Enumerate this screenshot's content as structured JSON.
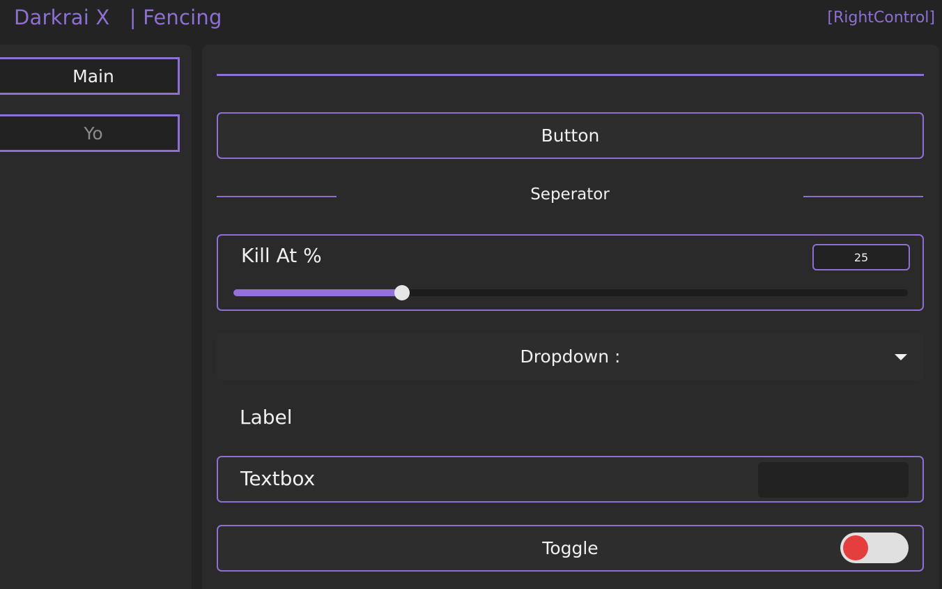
{
  "window": {
    "title": "Darkrai X   | Fencing",
    "keybind": "[RightControl]"
  },
  "sidebar": {
    "tabs": [
      {
        "label": "Main",
        "active": true
      },
      {
        "label": "Yo",
        "active": false
      }
    ]
  },
  "main": {
    "button": {
      "label": "Button"
    },
    "separator": {
      "label": "Seperator"
    },
    "slider": {
      "label": "Kill At %",
      "value": "25",
      "min": 0,
      "max": 100
    },
    "dropdown": {
      "label": "Dropdown :"
    },
    "label": {
      "text": "Label"
    },
    "textbox": {
      "label": "Textbox",
      "value": ""
    },
    "toggle": {
      "label": "Toggle",
      "state": false
    }
  },
  "colors": {
    "accent": "#8e6fd4",
    "toggle_off": "#e53e3e",
    "background": "#232323"
  }
}
